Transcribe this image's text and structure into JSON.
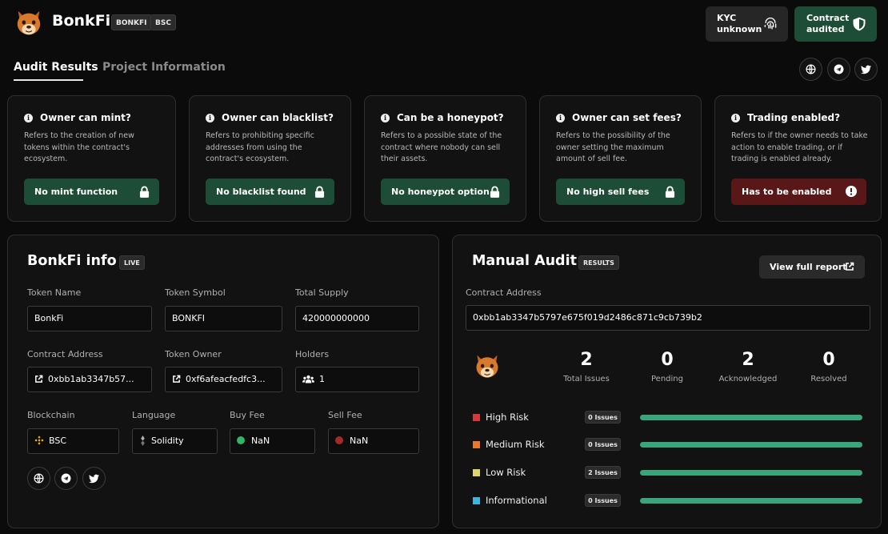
{
  "header": {
    "project_name": "BonkFi",
    "tags": [
      "BONKFI",
      "BSC"
    ],
    "kyc": {
      "line1": "KYC",
      "line2": "unknown"
    },
    "audit": {
      "line1": "Contract",
      "line2": "audited"
    }
  },
  "tabs": [
    {
      "label": "Audit Results",
      "active": true
    },
    {
      "label": "Project Information",
      "active": false
    }
  ],
  "social_icons": [
    "globe-icon",
    "telegram-icon",
    "twitter-icon"
  ],
  "checks": [
    {
      "title": "Owner can mint?",
      "desc": "Refers to the creation of new tokens within the contract's ecosystem.",
      "result": "No mint function",
      "status": "good",
      "icon": "lock-icon"
    },
    {
      "title": "Owner can blacklist?",
      "desc": "Refers to prohibiting specific addresses from using the contract's ecosystem.",
      "result": "No blacklist found",
      "status": "good",
      "icon": "lock-icon"
    },
    {
      "title": "Can be a honeypot?",
      "desc": "Refers to a possible state of the contract where nobody can sell their assets.",
      "result": "No honeypot option",
      "status": "good",
      "icon": "lock-icon"
    },
    {
      "title": "Owner can set fees?",
      "desc": "Refers to the possibility of the owner setting the maximum amount of sell fee.",
      "result": "No high sell fees",
      "status": "good",
      "icon": "lock-icon"
    },
    {
      "title": "Trading enabled?",
      "desc": "Refers to if the owner needs to take action to enable trading, or if trading is enabled already.",
      "result": "Has to be enabled",
      "status": "bad",
      "icon": "alert-icon"
    }
  ],
  "info": {
    "title": "BonkFi info",
    "badge": "LIVE",
    "token_name_label": "Token Name",
    "token_name": "BonkFi",
    "token_symbol_label": "Token Symbol",
    "token_symbol": "BONKFI",
    "total_supply_label": "Total Supply",
    "total_supply": "420000000000",
    "contract_address_label": "Contract Address",
    "contract_address": "0xbb1ab3347b57...",
    "token_owner_label": "Token Owner",
    "token_owner": "0xf6afeacfedfc3...",
    "holders_label": "Holders",
    "holders": "1",
    "blockchain_label": "Blockchain",
    "blockchain": "BSC",
    "language_label": "Language",
    "language": "Solidity",
    "buy_fee_label": "Buy Fee",
    "buy_fee": "NaN",
    "sell_fee_label": "Sell Fee",
    "sell_fee": "NaN",
    "colors": {
      "buy_fee_dot": "#2fb564",
      "sell_fee_dot": "#a32a2a",
      "bsc": "#f0b90b"
    }
  },
  "manual_audit": {
    "title": "Manual Audit",
    "badge": "RESULTS",
    "view_report": "View full report",
    "contract_address_label": "Contract Address",
    "contract_address": "0xbb1ab3347b5797e675f019d2486c871c9cb739b2",
    "stats": [
      {
        "value": "2",
        "label": "Total Issues"
      },
      {
        "value": "0",
        "label": "Pending"
      },
      {
        "value": "2",
        "label": "Acknowledged"
      },
      {
        "value": "0",
        "label": "Resolved"
      }
    ],
    "risks": [
      {
        "label": "High Risk",
        "issues": "0 Issues",
        "color": "#d6393a"
      },
      {
        "label": "Medium Risk",
        "issues": "0 Issues",
        "color": "#e8792a"
      },
      {
        "label": "Low Risk",
        "issues": "2 Issues",
        "color": "#e3d36b"
      },
      {
        "label": "Informational",
        "issues": "0 Issues",
        "color": "#3bb7dc"
      }
    ]
  }
}
